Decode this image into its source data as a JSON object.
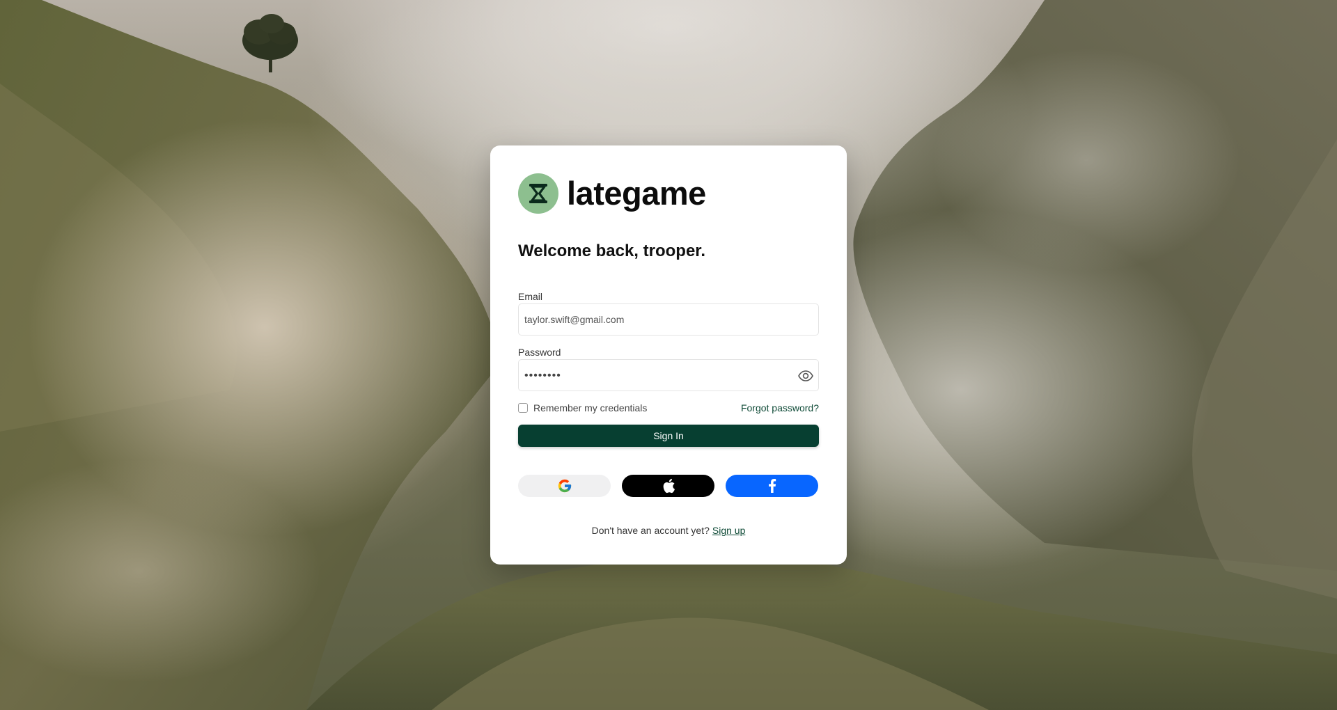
{
  "brand": {
    "name": "lategame",
    "logo_icon": "hourglass-icon",
    "logo_color": "#8dbf8f"
  },
  "login": {
    "welcome_text": "Welcome back, trooper.",
    "email_label": "Email",
    "email_value": "taylor.swift@gmail.com",
    "password_label": "Password",
    "password_masked": "••••••••",
    "show_password_icon": "eye-icon",
    "remember_label": "Remember my credentials",
    "remember_checked": false,
    "forgot_label": "Forgot password?",
    "signin_label": "Sign In",
    "signin_color": "#073f31"
  },
  "social": {
    "google_icon": "google-icon",
    "apple_icon": "apple-icon",
    "facebook_icon": "facebook-icon",
    "facebook_color": "#0866ff"
  },
  "signup": {
    "prompt": "Don't have an account yet?",
    "link_label": "Sign up"
  }
}
